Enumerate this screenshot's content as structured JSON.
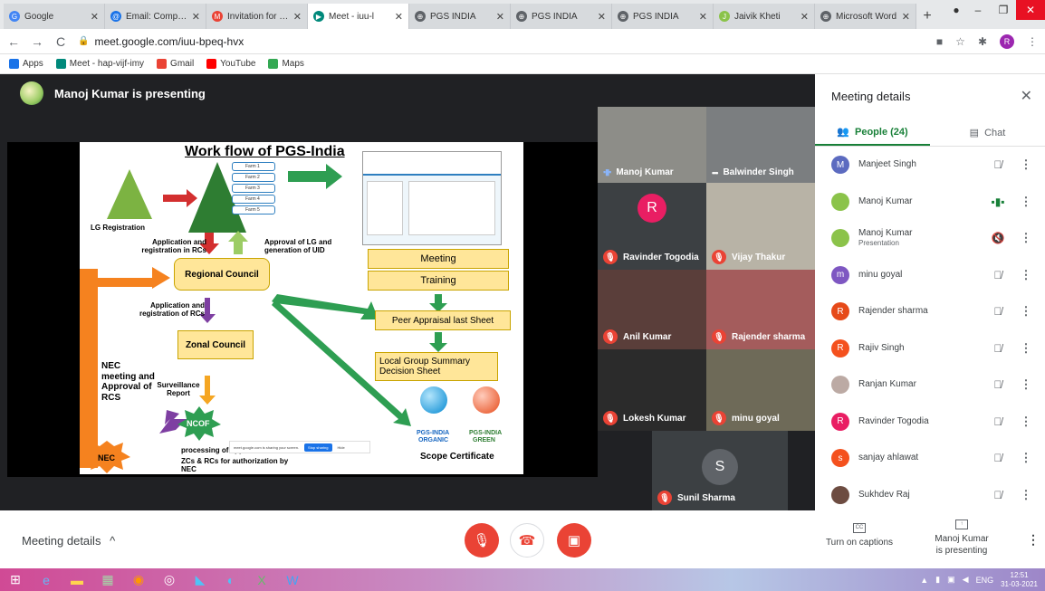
{
  "browser": {
    "tabs": [
      {
        "title": "Google",
        "fav_color": "#4285f4",
        "fav": "G"
      },
      {
        "title": "Email: Compose",
        "fav_color": "#1a73e8",
        "fav": "@"
      },
      {
        "title": "Invitation for att",
        "fav_color": "#ea4335",
        "fav": "M"
      },
      {
        "title": "Meet - iuu-l",
        "fav_color": "#00897b",
        "fav": "▶",
        "active": true
      },
      {
        "title": "PGS INDIA",
        "fav_color": "#5f6368",
        "fav": "⊕"
      },
      {
        "title": "PGS INDIA",
        "fav_color": "#5f6368",
        "fav": "⊕"
      },
      {
        "title": "PGS INDIA",
        "fav_color": "#5f6368",
        "fav": "⊕"
      },
      {
        "title": "Jaivik Kheti",
        "fav_color": "#8bc34a",
        "fav": "J"
      },
      {
        "title": "Microsoft Word",
        "fav_color": "#5f6368",
        "fav": "⊕"
      }
    ],
    "url": "meet.google.com/iuu-bpeq-hvx",
    "profile_initial": "R",
    "bookmarks": [
      {
        "label": "Apps",
        "color": "#1a73e8"
      },
      {
        "label": "Meet - hap-vijf-imy",
        "color": "#00897b"
      },
      {
        "label": "Gmail",
        "color": "#ea4335"
      },
      {
        "label": "YouTube",
        "color": "#ff0000"
      },
      {
        "label": "Maps",
        "color": "#34a853"
      }
    ]
  },
  "meet": {
    "presenting_text": "Manoj Kumar is presenting",
    "slide": {
      "title": "Work flow of PGS-India",
      "farms": [
        "Farm 1",
        "Farm 2",
        "Farm 3",
        "Farm 4",
        "Farm 5"
      ],
      "lg_registration": "LG Registration",
      "app_reg_rcs": "Application and registration in RCs",
      "approval_lg": "Approval of LG and generation of UID",
      "regional_council": "Regional Council",
      "app_reg_rcs2": "Application and registration of RCs",
      "zonal_council": "Zonal Council",
      "nec_meeting": "NEC meeting and Approval of RCS",
      "surveillance": "Surveillance Report",
      "ncof": "NCOF",
      "nec": "NEC",
      "processing": "processing of app",
      "processing2": "ZCs & RCs for authorization by NEC",
      "meeting": "Meeting",
      "training": "Training",
      "peer": "Peer Appraisal last Sheet",
      "summary": "Local Group Summary Decision Sheet",
      "scope": "Scope Certificate",
      "organic_1": "PGS-INDIA",
      "organic_2": "ORGANIC",
      "green_1": "PGS-INDIA",
      "green_2": "GREEN",
      "sharing_text": "meet.google.com is sharing your screen.",
      "stop_sharing": "Stop sharing",
      "hide": "Hide"
    },
    "tiles": [
      {
        "name": "Manoj Kumar",
        "mic": "on"
      },
      {
        "name": "Balwinder Singh",
        "mic": "dots"
      },
      {
        "name": "Ravinder Togodia",
        "mic": "off",
        "initial": "R",
        "color": "#e91e63"
      },
      {
        "name": "Vijay Thakur",
        "mic": "off"
      },
      {
        "name": "Anil Kumar",
        "mic": "off"
      },
      {
        "name": "Rajender sharma",
        "mic": "off"
      },
      {
        "name": "Lokesh Kumar",
        "mic": "off"
      },
      {
        "name": "minu goyal",
        "mic": "off"
      },
      {
        "name": "Sunil Sharma",
        "mic": "off",
        "initial": "S",
        "color": "#5f6368"
      }
    ]
  },
  "panel": {
    "title": "Meeting details",
    "people_tab": "People (24)",
    "chat_tab": "Chat",
    "people": [
      {
        "name": "Manjeet Singh",
        "initial": "M",
        "color": "#5c6bc0",
        "mic": "off"
      },
      {
        "name": "Manoj Kumar",
        "initial": "",
        "color": "#8bc34a",
        "mic": "on"
      },
      {
        "name": "Manoj Kumar",
        "sub": "Presentation",
        "initial": "",
        "color": "#8bc34a",
        "mic": "present"
      },
      {
        "name": "minu goyal",
        "initial": "m",
        "color": "#7e57c2",
        "mic": "off"
      },
      {
        "name": "Rajender sharma",
        "initial": "R",
        "color": "#e64a19",
        "mic": "off"
      },
      {
        "name": "Rajiv Singh",
        "initial": "R",
        "color": "#f4511e",
        "mic": "off"
      },
      {
        "name": "Ranjan Kumar",
        "initial": "",
        "color": "#bcaaa4",
        "mic": "off"
      },
      {
        "name": "Ravinder Togodia",
        "initial": "R",
        "color": "#e91e63",
        "mic": "off"
      },
      {
        "name": "sanjay ahlawat",
        "initial": "s",
        "color": "#f4511e",
        "mic": "off"
      },
      {
        "name": "Sukhdev Raj",
        "initial": "",
        "color": "#6d4c41",
        "mic": "off"
      }
    ]
  },
  "bottom": {
    "meeting_details": "Meeting details",
    "captions": "Turn on captions",
    "cc": "CC",
    "presenting_1": "Manoj Kumar",
    "presenting_2": "is presenting"
  },
  "taskbar": {
    "lang": "ENG",
    "time": "12:51",
    "date": "31-03-2021"
  }
}
